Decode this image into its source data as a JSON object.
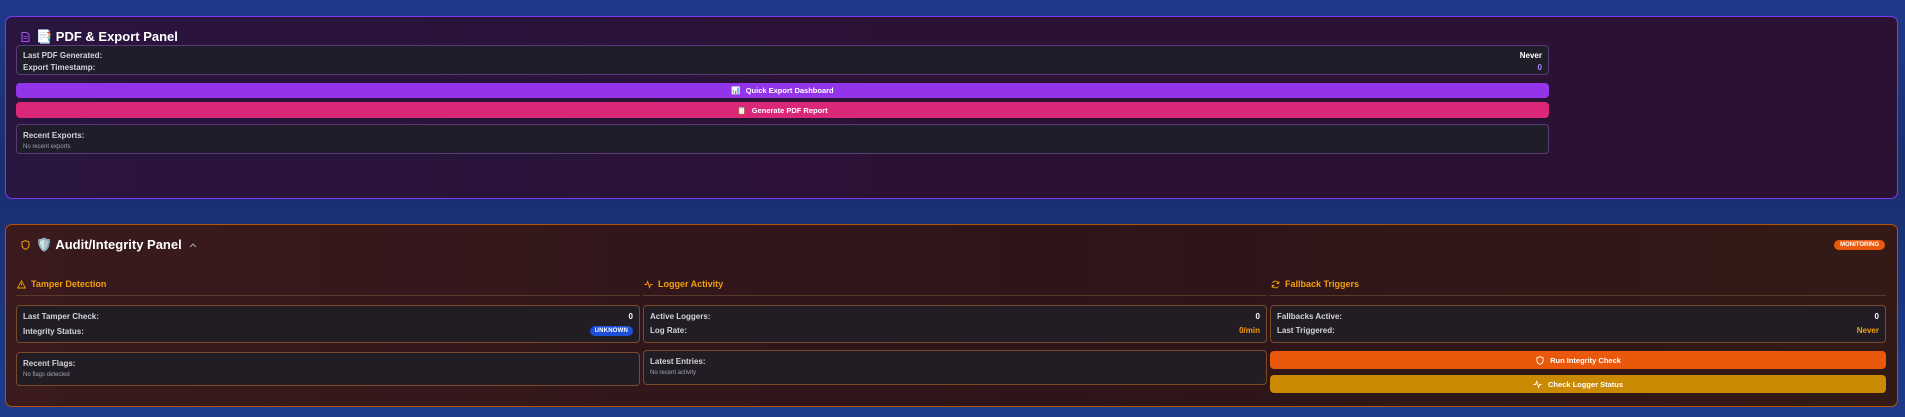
{
  "pdf_panel": {
    "title": "📑 PDF & Export Panel",
    "last_pdf_label": "Last PDF Generated:",
    "last_pdf_value": "Never",
    "export_ts_label": "Export Timestamp:",
    "export_ts_value": "0",
    "quick_export_label": "Quick Export Dashboard",
    "quick_export_emoji": "📊",
    "generate_pdf_label": "Generate PDF Report",
    "generate_pdf_emoji": "📋",
    "recent_exports_label": "Recent Exports:",
    "recent_exports_empty": "No recent exports",
    "colors": {
      "quick_export": "#9333ea",
      "generate_pdf": "#db2777",
      "border": "#7c3aed"
    }
  },
  "audit_panel": {
    "title": "🛡️ Audit/Integrity Panel",
    "status_badge": "MONITORING",
    "tamper": {
      "heading": "Tamper Detection",
      "last_check_label": "Last Tamper Check:",
      "last_check_value": "0",
      "integrity_label": "Integrity Status:",
      "integrity_value": "UNKNOWN",
      "recent_flags_label": "Recent Flags:",
      "recent_flags_empty": "No flags detected"
    },
    "logger": {
      "heading": "Logger Activity",
      "active_label": "Active Loggers:",
      "active_value": "0",
      "rate_label": "Log Rate:",
      "rate_value": "0/min",
      "latest_label": "Latest Entries:",
      "latest_empty": "No recent activity"
    },
    "fallback": {
      "heading": "Fallback Triggers",
      "active_label": "Fallbacks Active:",
      "active_value": "0",
      "triggered_label": "Last Triggered:",
      "triggered_value": "Never",
      "run_integrity_label": "Run Integrity Check",
      "check_logger_label": "Check Logger Status"
    },
    "colors": {
      "accent": "#f59e0b",
      "run_integrity": "#ea580c",
      "check_logger": "#ca8a04",
      "border": "#b45309"
    }
  }
}
